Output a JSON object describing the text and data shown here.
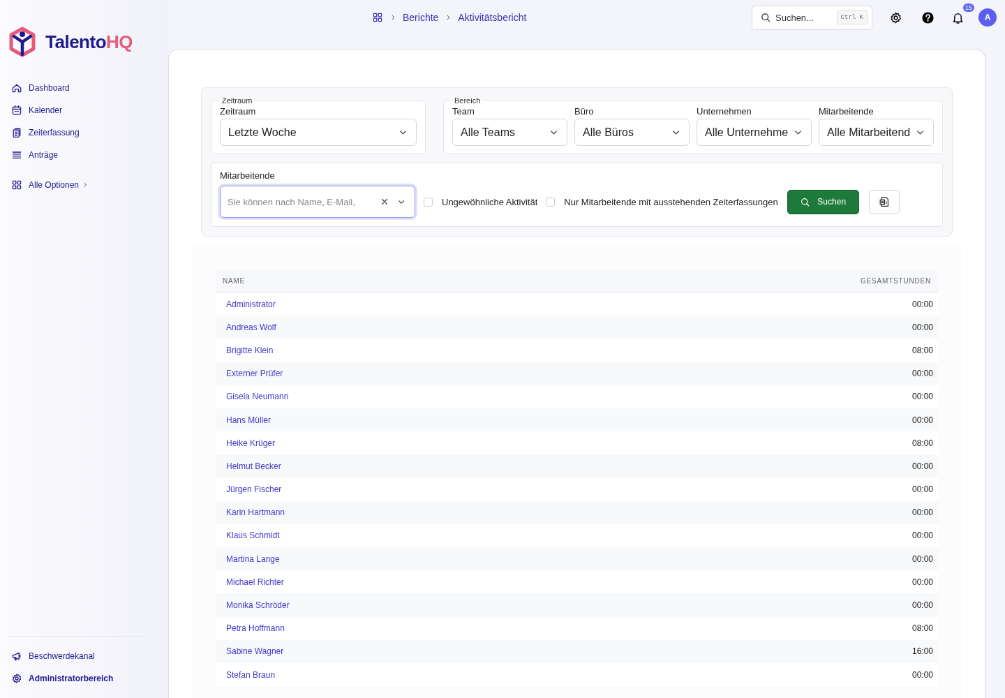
{
  "breadcrumb": [
    "Berichte",
    "Aktivitätsbericht"
  ],
  "topbar": {
    "search": {
      "placeholder": "Suchen...",
      "shortcut": "Ctrl K"
    },
    "notifications": "15",
    "avatar": "A"
  },
  "logo": {
    "main": "Talento",
    "accent": "HQ"
  },
  "sidebar": {
    "items": [
      {
        "label": "Dashboard",
        "kind": "home"
      },
      {
        "label": "Kalender",
        "kind": "calendar"
      },
      {
        "label": "Zeiterfassung",
        "kind": "clipboard"
      },
      {
        "label": "Anträge",
        "kind": "list"
      }
    ],
    "more": "Alle Optionen",
    "bottom": [
      {
        "label": "Beschwerdekanal",
        "kind": "megaphone"
      },
      {
        "label": "Administratorbereich",
        "kind": "gear"
      }
    ]
  },
  "filters": {
    "groups": [
      {
        "legend": "Zeitraum",
        "selects": [
          {
            "label": "Zeitraum",
            "value": "Letzte Woche"
          }
        ]
      },
      {
        "legend": "Bereich",
        "selects": [
          {
            "label": "Team",
            "value": "Alle Teams"
          },
          {
            "label": "Büro",
            "value": "Alle Büros"
          },
          {
            "label": "Unternehmen",
            "value": "Alle Unternehme"
          },
          {
            "label": "Mitarbeitende",
            "value": "Alle Mitarbeitend"
          }
        ]
      }
    ],
    "employee": {
      "label": "Mitarbeitende",
      "placeholder": "Sie können nach Name, E-Mail,"
    },
    "checkboxes": [
      {
        "label": "Ungewöhnliche Aktivität",
        "checked": false
      },
      {
        "label": "Nur Mitarbeitende mit ausstehenden Zeiterfassungen",
        "checked": false
      }
    ],
    "search_button": "Suchen"
  },
  "table": {
    "columns": [
      "NAME",
      "GESAMTSTUNDEN"
    ],
    "rows": [
      [
        "Administrator",
        "00:00"
      ],
      [
        "Andreas Wolf",
        "00:00"
      ],
      [
        "Brigitte Klein",
        "08:00"
      ],
      [
        "Externer Prüfer",
        "00:00"
      ],
      [
        "Gisela Neumann",
        "00:00"
      ],
      [
        "Hans Müller",
        "00:00"
      ],
      [
        "Heike Krüger",
        "08:00"
      ],
      [
        "Helmut Becker",
        "00:00"
      ],
      [
        "Jürgen Fischer",
        "00:00"
      ],
      [
        "Karin Hartmann",
        "00:00"
      ],
      [
        "Klaus Schmidt",
        "00:00"
      ],
      [
        "Martina Lange",
        "00:00"
      ],
      [
        "Michael Richter",
        "00:00"
      ],
      [
        "Monika Schröder",
        "00:00"
      ],
      [
        "Petra Hoffmann",
        "08:00"
      ],
      [
        "Sabine Wagner",
        "16:00"
      ],
      [
        "Stefan Braun",
        "00:00"
      ]
    ]
  }
}
